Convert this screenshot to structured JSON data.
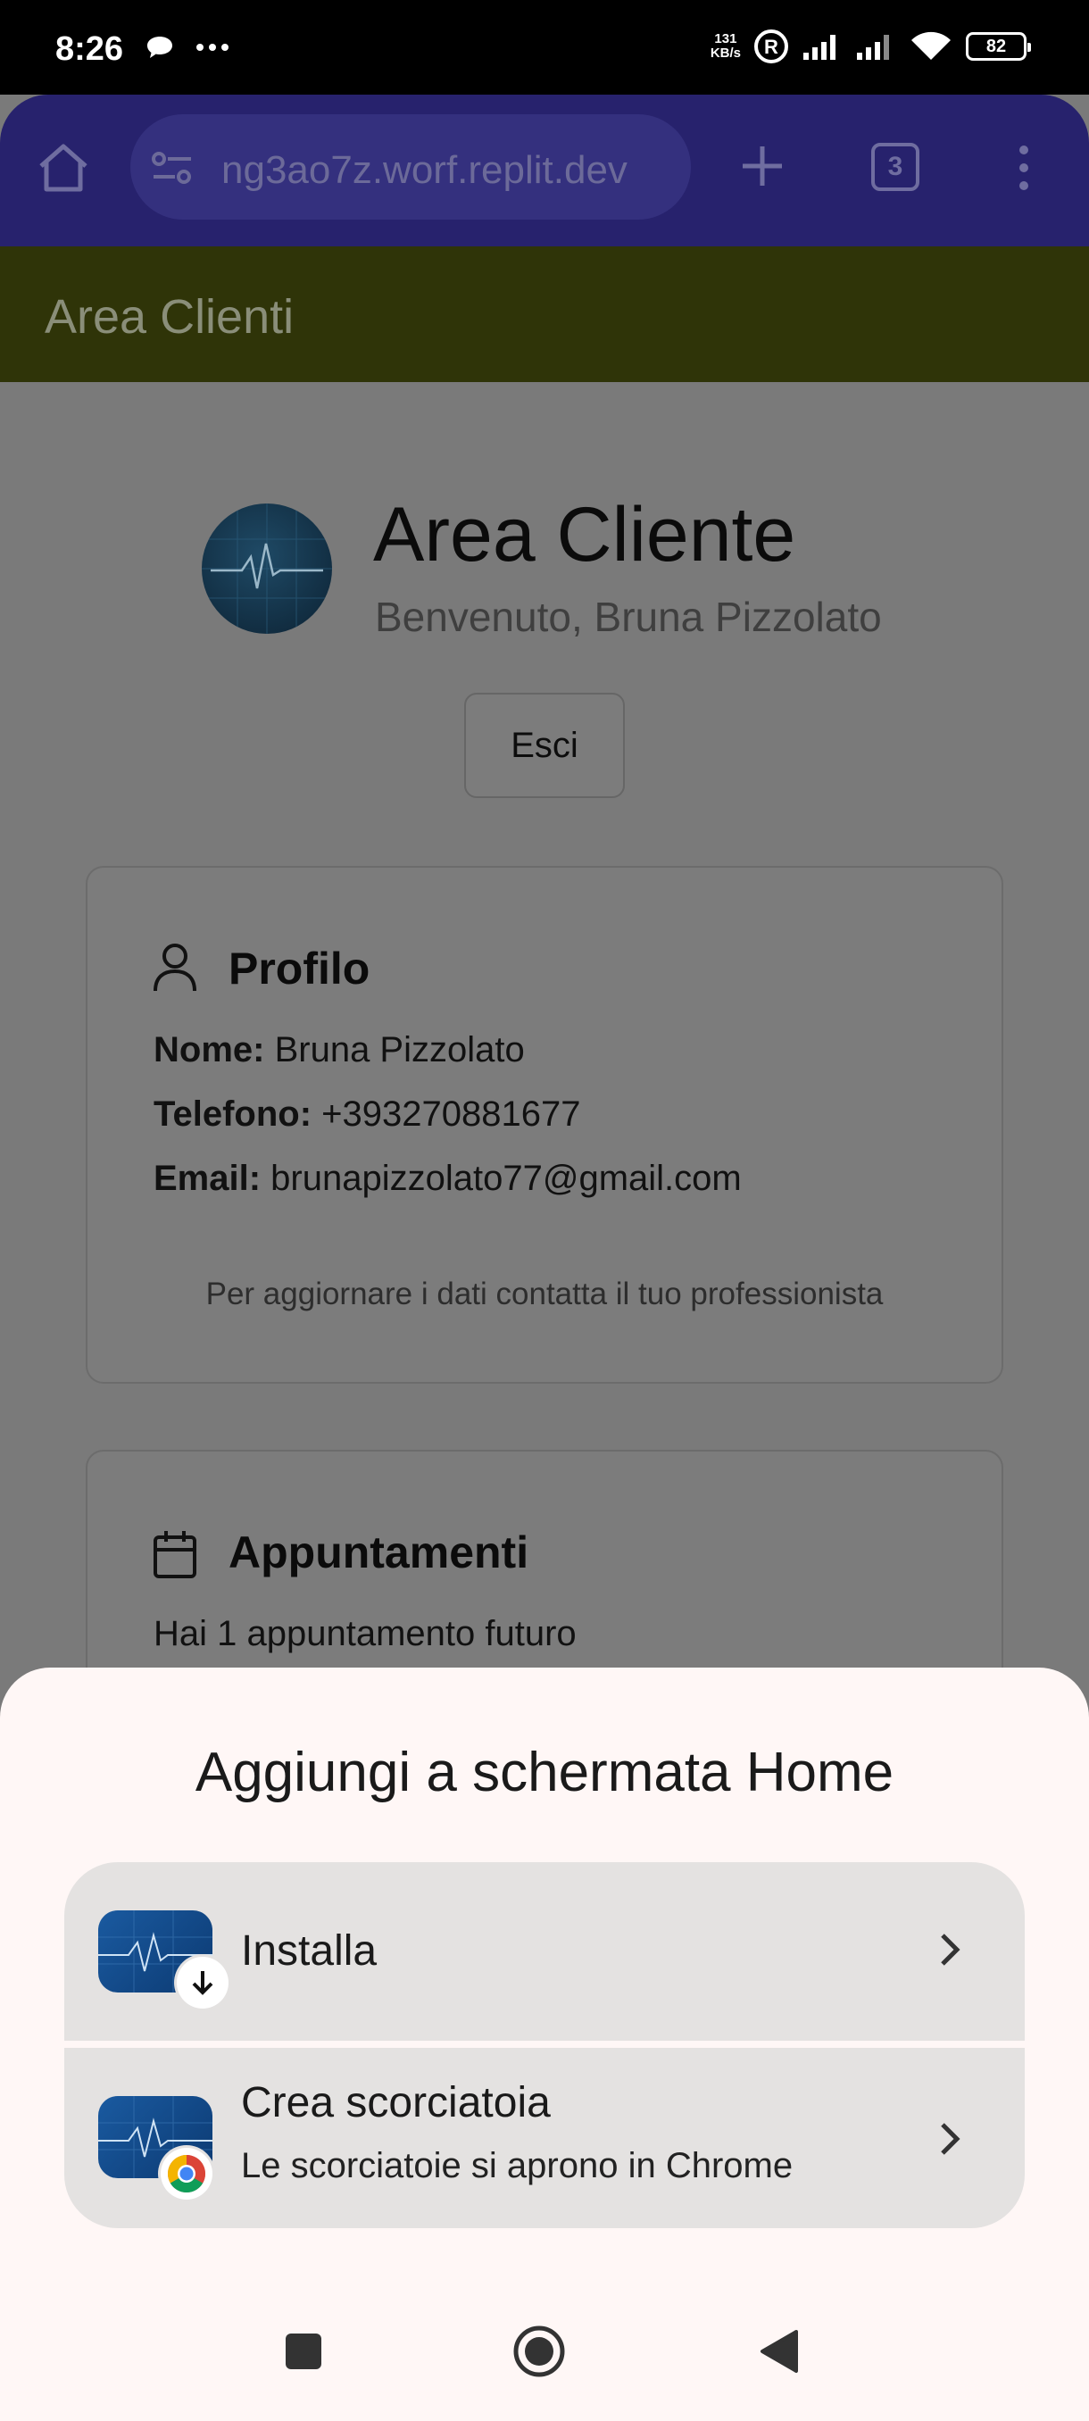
{
  "status_bar": {
    "time": "8:26",
    "net_speed_value": "131",
    "net_speed_unit": "KB/s",
    "battery": "82"
  },
  "browser": {
    "url": "ng3ao7z.worf.replit.dev",
    "tab_count": "3"
  },
  "page": {
    "header_title": "Area Clienti",
    "hero_title": "Area Cliente",
    "welcome": "Benvenuto, Bruna Pizzolato",
    "logout_label": "Esci",
    "profile": {
      "title": "Profilo",
      "name_label": "Nome:",
      "name_value": "Bruna Pizzolato",
      "phone_label": "Telefono:",
      "phone_value": "+393270881677",
      "email_label": "Email:",
      "email_value": "brunapizzolato77@gmail.com",
      "note": "Per aggiornare i dati contatta il tuo professionista"
    },
    "appointments": {
      "title": "Appuntamenti",
      "summary": "Hai 1 appuntamento futuro"
    }
  },
  "sheet": {
    "title": "Aggiungi a schermata Home",
    "install_label": "Installa",
    "shortcut_label": "Crea scorciatoia",
    "shortcut_sub": "Le scorciatoie si aprono in Chrome"
  },
  "icons": {
    "home": "home-icon",
    "tune": "site-settings-icon",
    "add": "plus-icon",
    "menu": "more-vert-icon",
    "person": "person-icon",
    "calendar": "calendar-icon",
    "download": "download-arrow-icon",
    "chrome": "chrome-icon",
    "chevron": "chevron-right-icon"
  },
  "colors": {
    "browser_toolbar": "#27226d",
    "page_header": "#2f3408",
    "scrim_page": "#7a7a7a",
    "sheet_bg": "#fff7f6",
    "option_bg": "#e4e2e1"
  }
}
